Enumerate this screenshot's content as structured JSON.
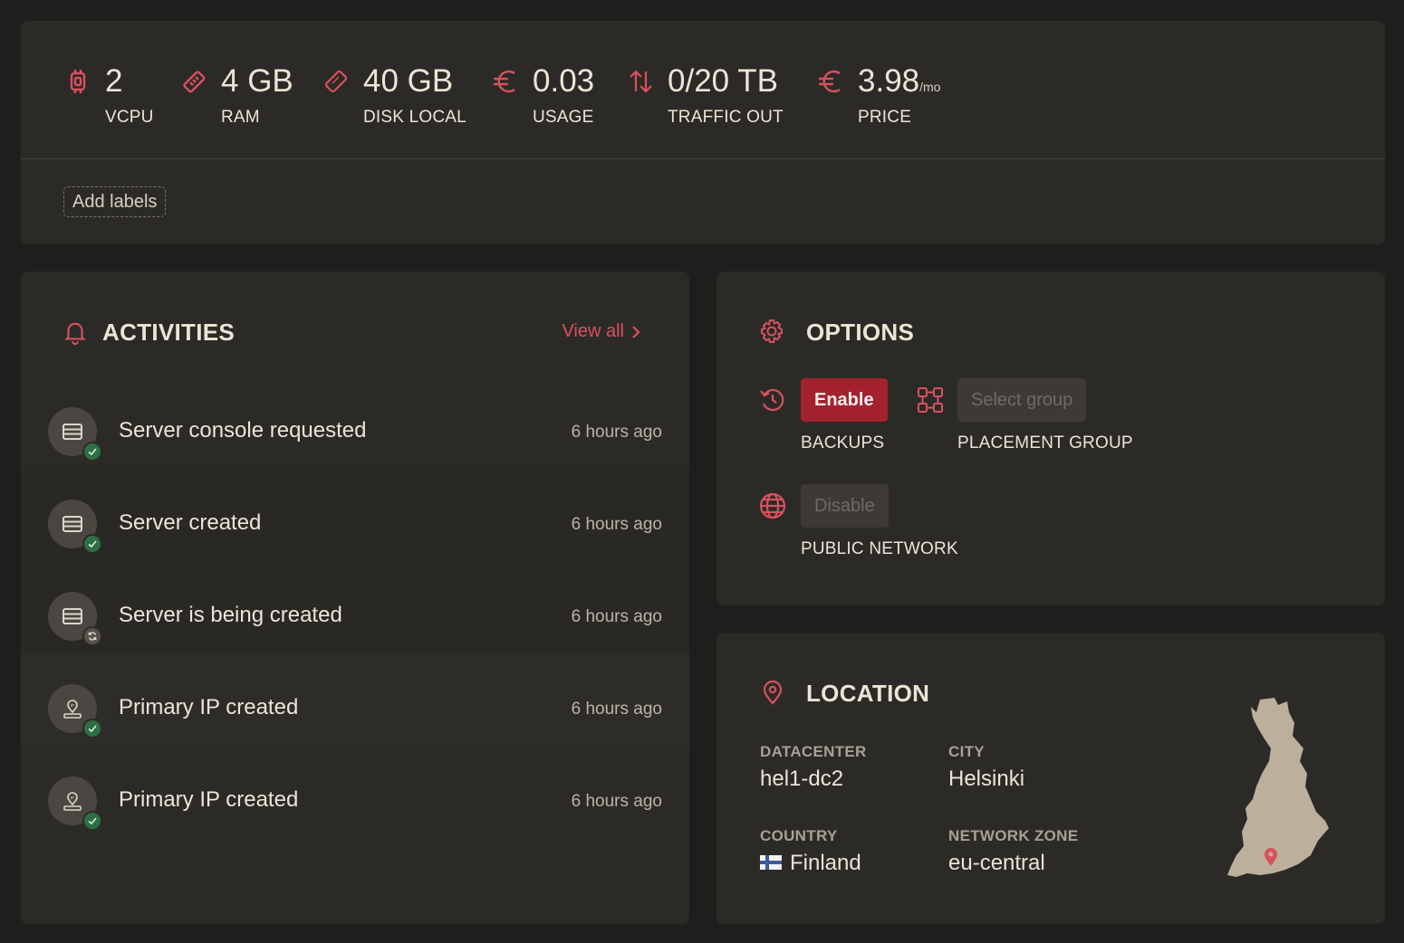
{
  "specs": [
    {
      "icon": "cpu-icon",
      "value": "2",
      "suffix": "",
      "label": "VCPU"
    },
    {
      "icon": "ram-icon",
      "value": "4 GB",
      "suffix": "",
      "label": "RAM"
    },
    {
      "icon": "disk-icon",
      "value": "40 GB",
      "suffix": "",
      "label": "DISK LOCAL"
    },
    {
      "icon": "euro-icon",
      "value": "0.03",
      "suffix": "",
      "label": "USAGE"
    },
    {
      "icon": "traffic-icon",
      "value": "0/20 TB",
      "suffix": "",
      "label": "TRAFFIC OUT"
    },
    {
      "icon": "euro-icon",
      "value": "3.98",
      "suffix": "/mo",
      "label": "PRICE"
    }
  ],
  "labels": {
    "add_label": "Add labels"
  },
  "activities": {
    "title": "ACTIVITIES",
    "view_all": "View all",
    "items": [
      {
        "text": "Server console requested",
        "time": "6 hours ago",
        "type": "server",
        "status": "done"
      },
      {
        "text": "Server created",
        "time": "6 hours ago",
        "type": "server",
        "status": "done"
      },
      {
        "text": "Server is being created",
        "time": "6 hours ago",
        "type": "server",
        "status": "in-progress"
      },
      {
        "text": "Primary IP created",
        "time": "6 hours ago",
        "type": "ip",
        "status": "done"
      },
      {
        "text": "Primary IP created",
        "time": "6 hours ago",
        "type": "ip",
        "status": "done"
      }
    ]
  },
  "options": {
    "title": "OPTIONS",
    "backups": {
      "button": "Enable",
      "label": "BACKUPS"
    },
    "placement_group": {
      "button": "Select group",
      "label": "PLACEMENT GROUP"
    },
    "public_network": {
      "button": "Disable",
      "label": "PUBLIC NETWORK"
    }
  },
  "location": {
    "title": "LOCATION",
    "datacenter": {
      "key": "DATACENTER",
      "value": "hel1-dc2"
    },
    "city": {
      "key": "CITY",
      "value": "Helsinki"
    },
    "country": {
      "key": "COUNTRY",
      "value": "Finland"
    },
    "network_zone": {
      "key": "NETWORK ZONE",
      "value": "eu-central"
    }
  },
  "colors": {
    "accent": "#d8515f",
    "primary_button": "#a3222e",
    "success_badge": "#2e6e45",
    "card_bg": "#2c2a27",
    "page_bg": "#1f1e1c"
  }
}
